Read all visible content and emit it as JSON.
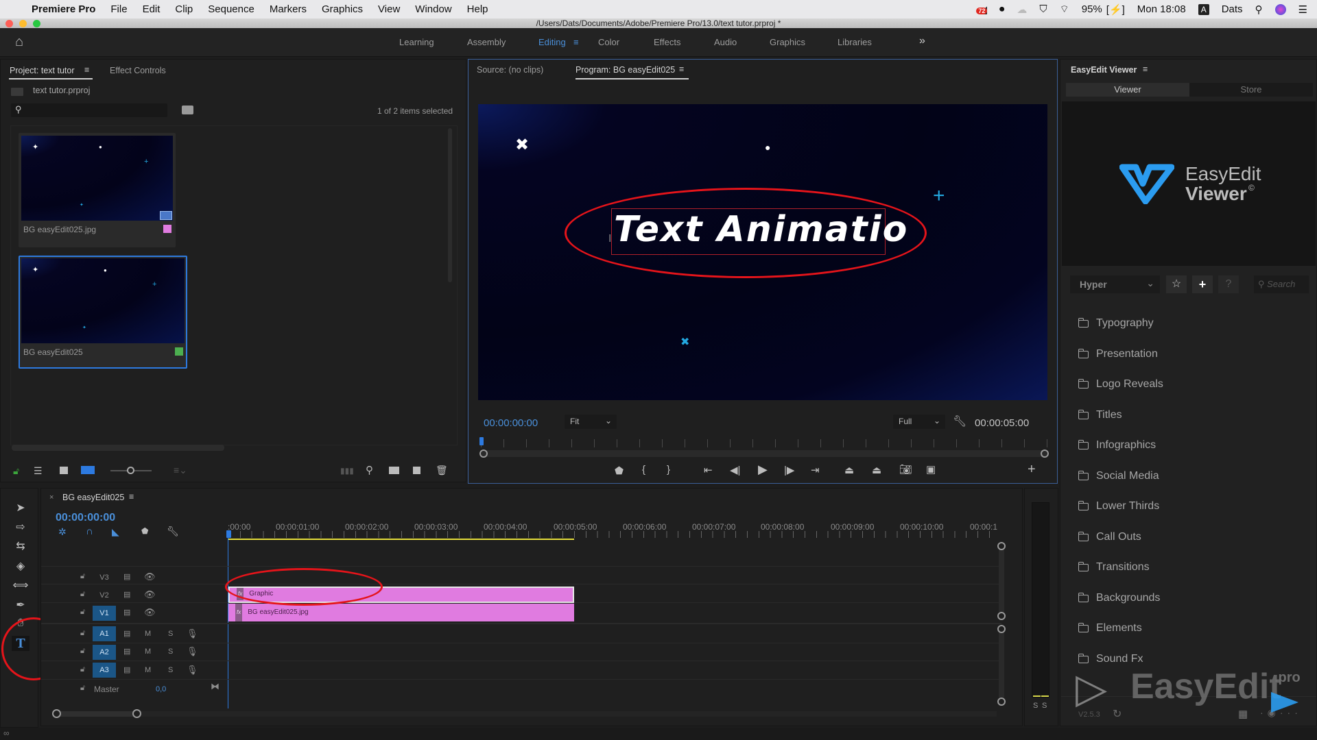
{
  "menubar": {
    "app_name": "Premiere Pro",
    "items": [
      "File",
      "Edit",
      "Clip",
      "Sequence",
      "Markers",
      "Graphics",
      "View",
      "Window",
      "Help"
    ],
    "status": {
      "notification_count": "72",
      "battery": "95%",
      "clock": "Mon 18:08",
      "input_source": "A",
      "user": "Dats"
    }
  },
  "window": {
    "title": "/Users/Dats/Documents/Adobe/Premiere Pro/13.0/text tutor.prproj *"
  },
  "workspaces": {
    "items": [
      {
        "label": "Learning",
        "active": false
      },
      {
        "label": "Assembly",
        "active": false
      },
      {
        "label": "Editing",
        "active": true
      },
      {
        "label": "Color",
        "active": false
      },
      {
        "label": "Effects",
        "active": false
      },
      {
        "label": "Audio",
        "active": false
      },
      {
        "label": "Graphics",
        "active": false
      },
      {
        "label": "Libraries",
        "active": false
      }
    ],
    "overflow": "»"
  },
  "project_panel": {
    "tab_active": "Project: text tutor",
    "tab_other": "Effect Controls",
    "project_file": "text tutor.prproj",
    "search_placeholder": "",
    "selection_status": "1 of 2 items selected",
    "items": [
      {
        "name": "BG easyEdit025.jpg",
        "label_color": "#e07be0",
        "selected": false
      },
      {
        "name": "BG easyEdit025",
        "label_color": "#4caf50",
        "selected": true
      }
    ]
  },
  "program_monitor": {
    "source_tab": "Source: (no clips)",
    "program_tab": "Program: BG easyEdit025",
    "overlay_text": "Text Animatio",
    "timecode_current": "00:00:00:00",
    "zoom_select": "Fit",
    "resolution_select": "Full",
    "timecode_duration": "00:00:05:00"
  },
  "timeline": {
    "sequence_name": "BG easyEdit025",
    "timecode": "00:00:00:00",
    "ruler_labels": [
      ":00:00",
      "00:00:01:00",
      "00:00:02:00",
      "00:00:03:00",
      "00:00:04:00",
      "00:00:05:00",
      "00:00:06:00",
      "00:00:07:00",
      "00:00:08:00",
      "00:00:09:00",
      "00:00:10:00",
      "00:00:1"
    ],
    "video_tracks": [
      {
        "name": "V3",
        "targeted": false
      },
      {
        "name": "V2",
        "targeted": false
      },
      {
        "name": "V1",
        "targeted": true
      }
    ],
    "audio_tracks": [
      {
        "name": "A1",
        "mute": "M",
        "solo": "S"
      },
      {
        "name": "A2",
        "mute": "M",
        "solo": "S"
      },
      {
        "name": "A3",
        "mute": "M",
        "solo": "S"
      }
    ],
    "master": {
      "label": "Master",
      "value": "0,0"
    },
    "clips": [
      {
        "track": "V2",
        "name": "Graphic",
        "fx": "fx"
      },
      {
        "track": "V1",
        "name": "BG easyEdit025.jpg",
        "fx": "fx"
      }
    ],
    "meter_solo_labels": [
      "S",
      "S"
    ]
  },
  "tools": [
    "selection-tool",
    "track-select-tool",
    "ripple-edit-tool",
    "razor-tool",
    "slip-tool",
    "pen-tool",
    "hand-tool",
    "type-tool"
  ],
  "easyedit_panel": {
    "title": "EasyEdit Viewer",
    "tabs": [
      {
        "label": "Viewer",
        "active": true
      },
      {
        "label": "Store",
        "active": false
      }
    ],
    "logo_line1": "EasyEdit",
    "logo_line2": "Viewer",
    "logo_mark": "©",
    "category_select": "Hyper",
    "search_placeholder": "Search",
    "help_label": "?",
    "categories": [
      "Typography",
      "Presentation",
      "Logo Reveals",
      "Titles",
      "Infographics",
      "Social Media",
      "Lower Thirds",
      "Call Outs",
      "Transitions",
      "Backgrounds",
      "Elements",
      "Sound Fx"
    ],
    "version": "V2.5.3",
    "watermark": "EasyEdit",
    "watermark_suffix": ".pro"
  },
  "colors": {
    "accent_blue": "#2d7ae0",
    "timecode_blue": "#4a8fd9",
    "clip_pink": "#e07be0",
    "annotation_red": "#e5141a"
  }
}
